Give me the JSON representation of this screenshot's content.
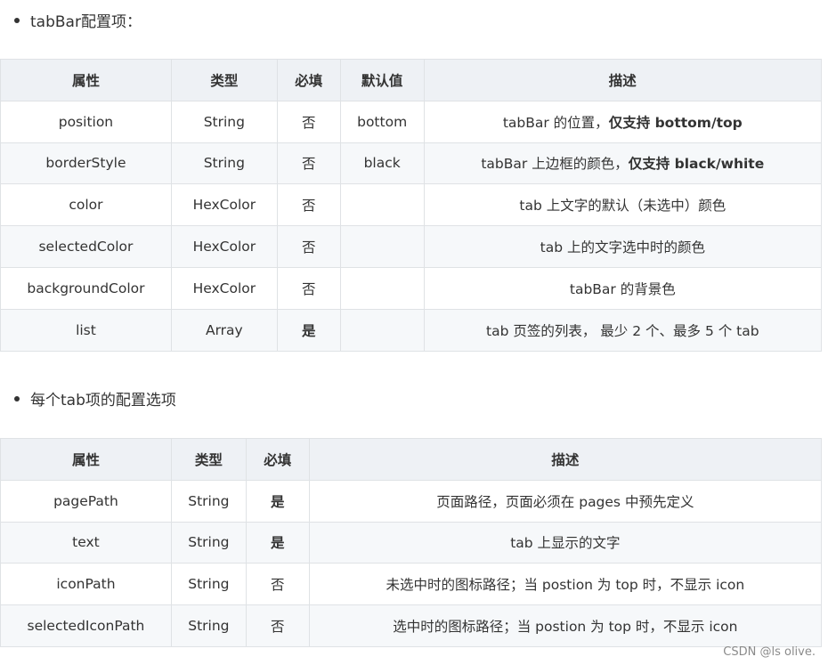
{
  "section1": {
    "bullet": "tabBar配置项："
  },
  "table1": {
    "headers": [
      "属性",
      "类型",
      "必填",
      "默认值",
      "描述"
    ],
    "rows": [
      {
        "prop": "position",
        "type": "String",
        "required": "否",
        "default": "bottom",
        "desc": "tabBar 的位置，",
        "desc_bold": "仅支持 bottom/top"
      },
      {
        "prop": "borderStyle",
        "type": "String",
        "required": "否",
        "default": "black",
        "desc": "tabBar 上边框的颜色，",
        "desc_bold": "仅支持 black/white"
      },
      {
        "prop": "color",
        "type": "HexColor",
        "required": "否",
        "default": "",
        "desc": "tab 上文字的默认（未选中）颜色",
        "desc_bold": ""
      },
      {
        "prop": "selectedColor",
        "type": "HexColor",
        "required": "否",
        "default": "",
        "desc": "tab 上的文字选中时的颜色",
        "desc_bold": ""
      },
      {
        "prop": "backgroundColor",
        "type": "HexColor",
        "required": "否",
        "default": "",
        "desc": "tabBar 的背景色",
        "desc_bold": ""
      },
      {
        "prop": "list",
        "type": "Array",
        "required": "是",
        "default": "",
        "desc": "tab 页签的列表， 最少 2 个、最多 5 个 tab",
        "desc_bold": ""
      }
    ]
  },
  "section2": {
    "bullet": "每个tab项的配置选项"
  },
  "table2": {
    "headers": [
      "属性",
      "类型",
      "必填",
      "描述"
    ],
    "rows": [
      {
        "prop": "pagePath",
        "type": "String",
        "required": "是",
        "desc": "页面路径，页面必须在 pages 中预先定义"
      },
      {
        "prop": "text",
        "type": "String",
        "required": "是",
        "desc": "tab 上显示的文字"
      },
      {
        "prop": "iconPath",
        "type": "String",
        "required": "否",
        "desc": "未选中时的图标路径；当 postion 为 top 时，不显示 icon"
      },
      {
        "prop": "selectedIconPath",
        "type": "String",
        "required": "否",
        "desc": "选中时的图标路径；当 postion 为 top 时，不显示 icon"
      }
    ]
  },
  "watermark": "CSDN @ls olive."
}
